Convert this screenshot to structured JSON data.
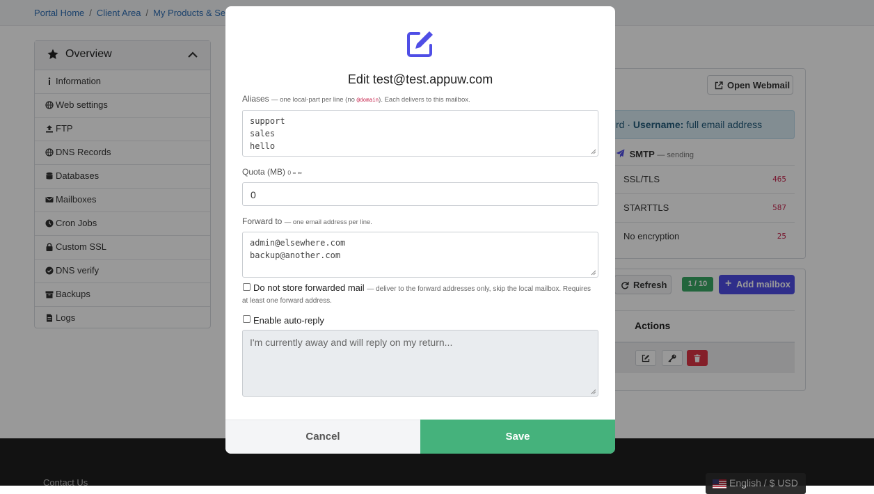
{
  "breadcrumb": [
    "Portal Home",
    "Client Area",
    "My Products & Se"
  ],
  "breadcrumb_sep": "/",
  "sidebar": {
    "title": "Overview",
    "items": [
      {
        "label": "Information",
        "icon": "info-icon"
      },
      {
        "label": "Web settings",
        "icon": "globe-icon"
      },
      {
        "label": "FTP",
        "icon": "upload-icon"
      },
      {
        "label": "DNS Records",
        "icon": "globe-icon"
      },
      {
        "label": "Databases",
        "icon": "database-icon"
      },
      {
        "label": "Mailboxes",
        "icon": "envelope-icon"
      },
      {
        "label": "Cron Jobs",
        "icon": "clock-icon"
      },
      {
        "label": "Custom SSL",
        "icon": "lock-icon"
      },
      {
        "label": "DNS verify",
        "icon": "check-circle-icon"
      },
      {
        "label": "Backups",
        "icon": "archive-icon"
      },
      {
        "label": "Logs",
        "icon": "file-icon"
      }
    ]
  },
  "right_panel": {
    "open_webmail": "Open Webmail",
    "info_lead": "rd",
    "info_sep": "·",
    "info_username_label": "Username:",
    "info_username_value": "full email address",
    "smtp_label": "SMTP",
    "smtp_sub": "— sending",
    "ports": [
      {
        "name": "SSL/TLS",
        "port": "465"
      },
      {
        "name": "STARTTLS",
        "port": "587"
      },
      {
        "name": "No encryption",
        "port": "25"
      }
    ],
    "refresh": "Refresh",
    "mailbox_count": "1 / 10",
    "add_mailbox": "Add mailbox",
    "actions_header": "Actions"
  },
  "footer": {
    "contact": "Contact Us",
    "language": "English / $ USD"
  },
  "modal": {
    "title": "Edit test@test.appuw.com",
    "aliases": {
      "label": "Aliases",
      "hint_before": "— one local-part per line (no",
      "hint_code": "@domain",
      "hint_after": "). Each delivers to this mailbox.",
      "lines": [
        "support",
        "sales",
        "hello"
      ]
    },
    "quota": {
      "label": "Quota (MB)",
      "hint": "0 = ∞",
      "value": "0"
    },
    "forward": {
      "label": "Forward to",
      "hint": "— one email address per line.",
      "lines": [
        "admin@elsewhere.com",
        "backup@another.com"
      ]
    },
    "no_store": {
      "label": "Do not store forwarded mail",
      "hint_line1": "— deliver to the forward addresses only, skip the local mailbox. Requires",
      "hint_line2": "at least one forward address.",
      "checked": false
    },
    "autoreply": {
      "label": "Enable auto-reply",
      "placeholder": "I'm currently away and will reply on my return...",
      "checked": false
    },
    "cancel": "Cancel",
    "save": "Save"
  },
  "colors": {
    "accent": "#4f4ee6",
    "save": "#45b27c",
    "danger": "#dc3545",
    "badge": "#3aa864",
    "link": "#2f6fb5"
  }
}
